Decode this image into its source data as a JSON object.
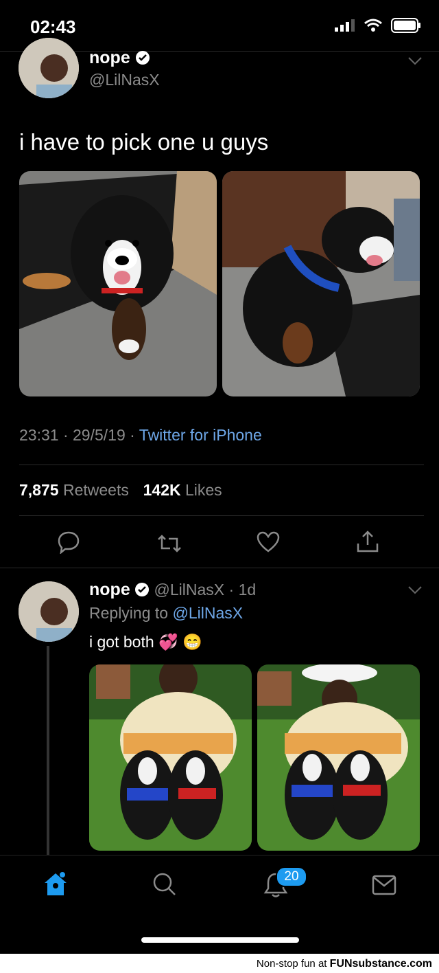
{
  "status": {
    "time": "02:43"
  },
  "main_tweet": {
    "display_name": "nope",
    "handle": "@LilNasX",
    "text": "i have to pick one u guys",
    "time": "23:31",
    "date": "29/5/19",
    "source": "Twitter for iPhone",
    "retweets_count": "7,875",
    "retweets_label": "Retweets",
    "likes_count": "142K",
    "likes_label": "Likes"
  },
  "reply_tweet": {
    "display_name": "nope",
    "handle": "@LilNasX",
    "age": "1d",
    "replying_prefix": "Replying to",
    "replying_to": "@LilNasX",
    "text": "i got both",
    "emoji": "💞 😁"
  },
  "tabbar": {
    "notifications_badge": "20"
  },
  "footer": {
    "text_prefix": "Non-stop fun at",
    "brand": "FUNsubstance.com"
  },
  "colors": {
    "accent": "#1d9bf0",
    "link": "#6ea7e8",
    "muted": "#8b8b8b"
  }
}
